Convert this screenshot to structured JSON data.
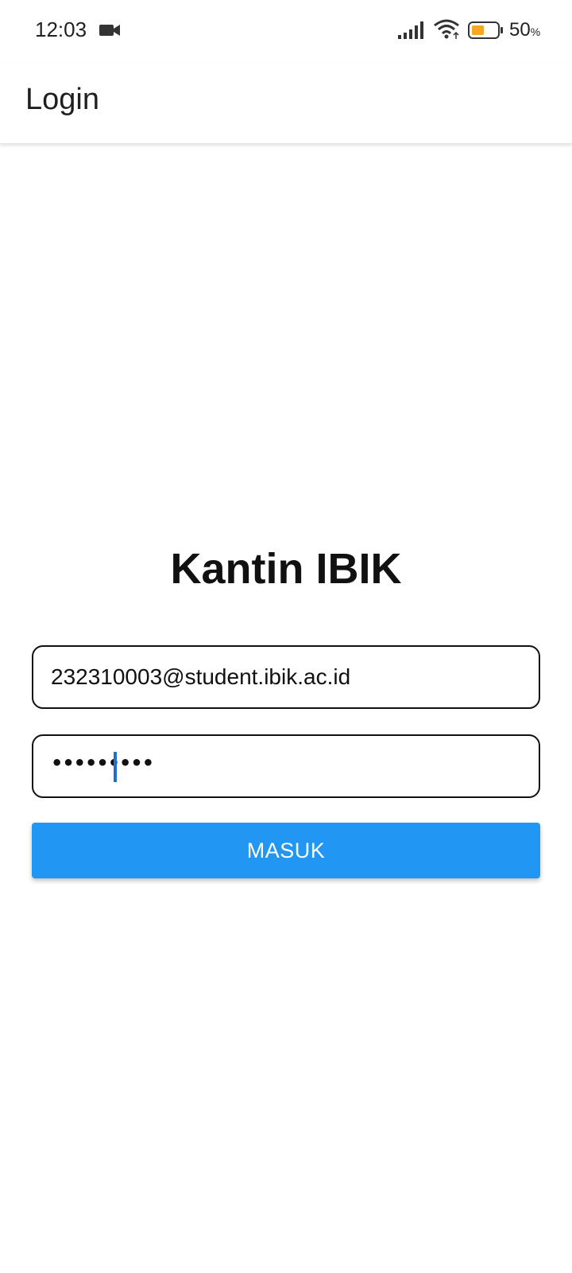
{
  "status_bar": {
    "time": "12:03",
    "battery_percent": "50",
    "battery_percent_sign": "%",
    "icons": [
      "video-camera-icon",
      "signal-icon",
      "wifi-icon",
      "battery-icon"
    ],
    "battery_fill_color": "#f5a623"
  },
  "app_bar": {
    "title": "Login"
  },
  "main": {
    "heading": "Kantin IBIK",
    "email_field": {
      "value": "232310003@student.ibik.ac.id"
    },
    "password_field": {
      "masked_value": "•••••••••"
    },
    "login_button": {
      "label": "MASUK"
    }
  },
  "colors": {
    "accent": "#2196f3",
    "cursor": "#1f6fd1"
  }
}
